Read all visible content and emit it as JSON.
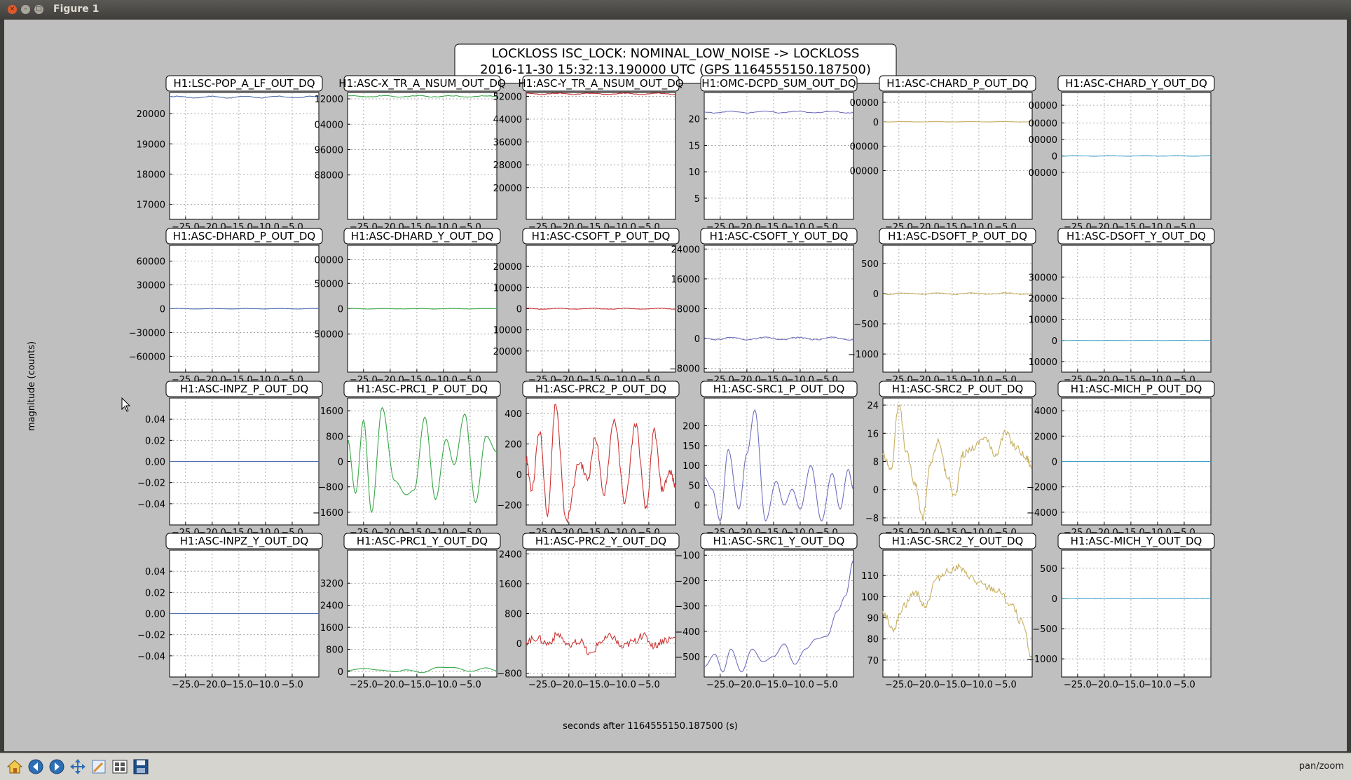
{
  "window": {
    "title": "Figure 1",
    "close_icon": "×",
    "minimize_icon": "–",
    "maximize_icon": "□"
  },
  "figure": {
    "suptitle_line1": "LOCKLOSS ISC_LOCK: NOMINAL_LOW_NOISE -> LOCKLOSS",
    "suptitle_line2": "2016-11-30 15:32:13.190000 UTC (GPS 1164555150.187500)",
    "ylabel": "magnitude (counts)",
    "xlabel": "seconds after 1164555150.187500 (s)"
  },
  "toolbar": {
    "buttons": [
      "home-icon",
      "back-icon",
      "forward-icon",
      "pan-icon",
      "zoom-icon",
      "subplots-icon",
      "save-icon"
    ],
    "status": "pan/zoom"
  },
  "colors": {
    "blue": "#4f6fb0",
    "green": "#3aa84a",
    "red": "#cc3333",
    "purple": "#6f6fbf",
    "tan": "#c8b060",
    "cyan": "#3fa0c8"
  },
  "chart_data": [
    {
      "title": "H1:LSC-POP_A_LF_OUT_DQ",
      "type": "line",
      "color": "blue",
      "ylim": [
        16500,
        20700
      ],
      "yticks": [
        "20000",
        "19000",
        "18000",
        "17000"
      ],
      "ytickvals": [
        20000,
        19000,
        18000,
        17000
      ],
      "xlim": [
        -28,
        0
      ],
      "kind": "flat",
      "level": 20550,
      "amp": 25
    },
    {
      "title": "H1:ASC-X_TR_A_NSUM_OUT_DQ",
      "type": "line",
      "color": "green",
      "ylim": [
        0,
        10
      ],
      "yticks": [
        "12000",
        "04000",
        "96000",
        "88000"
      ],
      "ytickvals": [
        9.5,
        7.5,
        5.5,
        3.5
      ],
      "xlim": [
        -28,
        0
      ],
      "kind": "flat",
      "level": 9.7,
      "amp": 0.05
    },
    {
      "title": "H1:ASC-Y_TR_A_NSUM_OUT_DQ",
      "type": "line",
      "color": "red",
      "ylim": [
        0,
        10
      ],
      "yticks": [
        "52000",
        "44000",
        "36000",
        "28000",
        "20000"
      ],
      "ytickvals": [
        9.7,
        7.9,
        6.1,
        4.3,
        2.5
      ],
      "xlim": [
        -28,
        0
      ],
      "kind": "flat",
      "level": 9.9,
      "amp": 0.05
    },
    {
      "title": "H1:OMC-DCPD_SUM_OUT_DQ",
      "type": "line",
      "color": "purple",
      "ylim": [
        1,
        25
      ],
      "yticks": [
        "20",
        "15",
        "10",
        "5"
      ],
      "ytickvals": [
        20,
        15,
        10,
        5
      ],
      "xlim": [
        -28,
        0
      ],
      "kind": "flat",
      "level": 21.3,
      "amp": 0.15
    },
    {
      "title": "H1:ASC-CHARD_P_OUT_DQ",
      "type": "line",
      "color": "tan",
      "ylim": [
        -10,
        3
      ],
      "yticks": [
        "00000",
        "0",
        "00000",
        "00000"
      ],
      "ytickvals": [
        2,
        0,
        -2.5,
        -5
      ],
      "xlim": [
        -28,
        0
      ],
      "kind": "flat",
      "level": 0,
      "amp": 0.02
    },
    {
      "title": "H1:ASC-CHARD_Y_OUT_DQ",
      "type": "line",
      "color": "cyan",
      "ylim": [
        -5,
        5
      ],
      "yticks": [
        "00000",
        "00000",
        "00000",
        "0",
        "00000"
      ],
      "ytickvals": [
        4,
        2.6,
        1.3,
        0,
        -1.3
      ],
      "xlim": [
        -28,
        0
      ],
      "kind": "flat",
      "level": 0,
      "amp": 0.02
    },
    {
      "title": "H1:ASC-DHARD_P_OUT_DQ",
      "type": "line",
      "color": "blue",
      "ylim": [
        -80000,
        80000
      ],
      "yticks": [
        "60000",
        "30000",
        "0",
        "−30000",
        "−60000"
      ],
      "ytickvals": [
        60000,
        30000,
        0,
        -30000,
        -60000
      ],
      "xlim": [
        -28,
        0
      ],
      "kind": "flat",
      "level": 0,
      "amp": 300
    },
    {
      "title": "H1:ASC-DHARD_Y_OUT_DQ",
      "type": "line",
      "color": "green",
      "ylim": [
        -80000,
        80000
      ],
      "yticks": [
        "00000",
        "50000",
        "0",
        "50000"
      ],
      "ytickvals": [
        62000,
        32000,
        0,
        -32000
      ],
      "xlim": [
        -28,
        0
      ],
      "kind": "flat",
      "level": 0,
      "amp": 300
    },
    {
      "title": "H1:ASC-CSOFT_P_OUT_DQ",
      "type": "line",
      "color": "red",
      "ylim": [
        -30000,
        30000
      ],
      "yticks": [
        "20000",
        "10000",
        "0",
        "10000",
        "20000"
      ],
      "ytickvals": [
        20000,
        10000,
        0,
        -10000,
        -20000
      ],
      "xlim": [
        -28,
        0
      ],
      "kind": "flat",
      "level": 0,
      "amp": 200
    },
    {
      "title": "H1:ASC-CSOFT_Y_OUT_DQ",
      "type": "line",
      "color": "purple",
      "ylim": [
        -9000,
        25000
      ],
      "yticks": [
        "24000",
        "16000",
        "8000",
        "0",
        "−8000"
      ],
      "ytickvals": [
        24000,
        16000,
        8000,
        0,
        -8000
      ],
      "xlim": [
        -28,
        0
      ],
      "kind": "flat",
      "level": 0,
      "amp": 300
    },
    {
      "title": "H1:ASC-DSOFT_P_OUT_DQ",
      "type": "line",
      "color": "tan",
      "ylim": [
        -1300,
        800
      ],
      "yticks": [
        "500",
        "0",
        "−500",
        "−1000"
      ],
      "ytickvals": [
        500,
        0,
        -500,
        -1000
      ],
      "xlim": [
        -28,
        0
      ],
      "kind": "flat",
      "level": 0,
      "amp": 12
    },
    {
      "title": "H1:ASC-DSOFT_Y_OUT_DQ",
      "type": "line",
      "color": "cyan",
      "ylim": [
        -15000,
        45000
      ],
      "yticks": [
        "30000",
        "20000",
        "10000",
        "0",
        "10000"
      ],
      "ytickvals": [
        30000,
        20000,
        10000,
        0,
        -10000
      ],
      "xlim": [
        -28,
        0
      ],
      "kind": "flat",
      "level": 0,
      "amp": 50
    },
    {
      "title": "H1:ASC-INPZ_P_OUT_DQ",
      "type": "line",
      "color": "blue",
      "ylim": [
        -0.06,
        0.06
      ],
      "yticks": [
        "0.04",
        "0.02",
        "0.00",
        "−0.02",
        "−0.04"
      ],
      "ytickvals": [
        0.04,
        0.02,
        0,
        -0.02,
        -0.04
      ],
      "xlim": [
        -28,
        0
      ],
      "kind": "flat",
      "level": 0,
      "amp": 0
    },
    {
      "title": "H1:ASC-PRC1_P_OUT_DQ",
      "type": "line",
      "color": "green",
      "ylim": [
        -2000,
        2000
      ],
      "yticks": [
        "1600",
        "800",
        "0",
        "−800",
        "−1600"
      ],
      "ytickvals": [
        1600,
        800,
        0,
        -800,
        -1600
      ],
      "xlim": [
        -28,
        0
      ],
      "kind": "osc",
      "points": [
        [
          -28,
          700
        ],
        [
          -26.5,
          -1000
        ],
        [
          -25,
          1300
        ],
        [
          -23.5,
          -1600
        ],
        [
          -21.5,
          1700
        ],
        [
          -19.2,
          -600
        ],
        [
          -17,
          -1050
        ],
        [
          -15.5,
          -900
        ],
        [
          -13.5,
          1400
        ],
        [
          -11.5,
          -1200
        ],
        [
          -9.5,
          700
        ],
        [
          -8,
          -100
        ],
        [
          -6,
          1500
        ],
        [
          -4,
          -1300
        ],
        [
          -2,
          800
        ],
        [
          0,
          300
        ]
      ]
    },
    {
      "title": "H1:ASC-PRC2_P_OUT_DQ",
      "type": "line",
      "color": "red",
      "ylim": [
        -330,
        500
      ],
      "yticks": [
        "400",
        "200",
        "0",
        "−200"
      ],
      "ytickvals": [
        400,
        200,
        0,
        -200
      ],
      "xlim": [
        -28,
        0
      ],
      "kind": "osc",
      "noisy": true,
      "points": [
        [
          -28,
          100
        ],
        [
          -27,
          -100
        ],
        [
          -25.5,
          280
        ],
        [
          -24,
          -250
        ],
        [
          -22.5,
          460
        ],
        [
          -20.5,
          -300
        ],
        [
          -18,
          80
        ],
        [
          -16.5,
          -30
        ],
        [
          -15,
          240
        ],
        [
          -13.5,
          -130
        ],
        [
          -11.5,
          360
        ],
        [
          -9.5,
          -180
        ],
        [
          -7.5,
          330
        ],
        [
          -5.5,
          -230
        ],
        [
          -4,
          290
        ],
        [
          -2.5,
          -100
        ],
        [
          -1,
          20
        ],
        [
          0,
          -80
        ]
      ]
    },
    {
      "title": "H1:ASC-SRC1_P_OUT_DQ",
      "type": "line",
      "color": "purple",
      "ylim": [
        -50,
        270
      ],
      "yticks": [
        "200",
        "150",
        "100",
        "50",
        "0"
      ],
      "ytickvals": [
        200,
        150,
        100,
        50,
        0
      ],
      "xlim": [
        -28,
        0
      ],
      "kind": "osc",
      "points": [
        [
          -28,
          70
        ],
        [
          -26.5,
          40
        ],
        [
          -25,
          -40
        ],
        [
          -23.5,
          140
        ],
        [
          -21.5,
          -10
        ],
        [
          -20,
          130
        ],
        [
          -18.5,
          240
        ],
        [
          -16.5,
          -40
        ],
        [
          -14.5,
          60
        ],
        [
          -13,
          0
        ],
        [
          -11.5,
          40
        ],
        [
          -10,
          -10
        ],
        [
          -8,
          100
        ],
        [
          -6,
          -40
        ],
        [
          -4,
          80
        ],
        [
          -2.5,
          -10
        ],
        [
          -1,
          90
        ],
        [
          0,
          40
        ]
      ]
    },
    {
      "title": "H1:ASC-SRC2_P_OUT_DQ",
      "type": "line",
      "color": "tan",
      "ylim": [
        -10,
        26
      ],
      "yticks": [
        "24",
        "16",
        "8",
        "0",
        "−8"
      ],
      "ytickvals": [
        24,
        16,
        8,
        0,
        -8
      ],
      "xlim": [
        -28,
        0
      ],
      "kind": "osc",
      "noisy": true,
      "points": [
        [
          -28,
          10
        ],
        [
          -26.5,
          6
        ],
        [
          -25,
          24
        ],
        [
          -23.5,
          10
        ],
        [
          -22,
          2
        ],
        [
          -20.5,
          -8
        ],
        [
          -19,
          8
        ],
        [
          -17.5,
          14
        ],
        [
          -16,
          4
        ],
        [
          -14.5,
          -2
        ],
        [
          -13,
          10
        ],
        [
          -11,
          12
        ],
        [
          -9,
          15
        ],
        [
          -7,
          10
        ],
        [
          -5,
          16
        ],
        [
          -3,
          12
        ],
        [
          -1,
          9
        ],
        [
          0,
          6
        ]
      ]
    },
    {
      "title": "H1:ASC-MICH_P_OUT_DQ",
      "type": "line",
      "color": "cyan",
      "ylim": [
        -5000,
        5000
      ],
      "yticks": [
        "4000",
        "2000",
        "0",
        "−2000",
        "−4000"
      ],
      "ytickvals": [
        4000,
        2000,
        0,
        -2000,
        -4000
      ],
      "xlim": [
        -28,
        0
      ],
      "kind": "flat",
      "level": 0,
      "amp": 5
    },
    {
      "title": "H1:ASC-INPZ_Y_OUT_DQ",
      "type": "line",
      "color": "blue",
      "ylim": [
        -0.06,
        0.06
      ],
      "yticks": [
        "0.04",
        "0.02",
        "0.00",
        "−0.02",
        "−0.04"
      ],
      "ytickvals": [
        0.04,
        0.02,
        0,
        -0.02,
        -0.04
      ],
      "xlim": [
        -28,
        0
      ],
      "kind": "flat",
      "level": 0,
      "amp": 0
    },
    {
      "title": "H1:ASC-PRC1_Y_OUT_DQ",
      "type": "line",
      "color": "green",
      "ylim": [
        -200,
        4400
      ],
      "yticks": [
        "3200",
        "2400",
        "1600",
        "800",
        "0"
      ],
      "ytickvals": [
        3200,
        2400,
        1600,
        800,
        0
      ],
      "xlim": [
        -28,
        0
      ],
      "kind": "osc",
      "points": [
        [
          -28,
          40
        ],
        [
          -25,
          110
        ],
        [
          -22,
          50
        ],
        [
          -19,
          -10
        ],
        [
          -17,
          60
        ],
        [
          -14,
          -40
        ],
        [
          -11,
          150
        ],
        [
          -8,
          140
        ],
        [
          -5,
          0
        ],
        [
          -2,
          130
        ],
        [
          0,
          30
        ]
      ]
    },
    {
      "title": "H1:ASC-PRC2_Y_OUT_DQ",
      "type": "line",
      "color": "red",
      "ylim": [
        -900,
        2500
      ],
      "yticks": [
        "2400",
        "1600",
        "800",
        "0",
        "−800"
      ],
      "ytickvals": [
        2400,
        1600,
        800,
        0,
        -800
      ],
      "xlim": [
        -28,
        0
      ],
      "kind": "osc",
      "noisy": true,
      "points": [
        [
          -28,
          60
        ],
        [
          -26,
          150
        ],
        [
          -24,
          0
        ],
        [
          -22,
          250
        ],
        [
          -20,
          -100
        ],
        [
          -18,
          60
        ],
        [
          -16,
          -300
        ],
        [
          -14,
          60
        ],
        [
          -12,
          200
        ],
        [
          -10,
          -100
        ],
        [
          -8,
          50
        ],
        [
          -6,
          200
        ],
        [
          -4,
          -50
        ],
        [
          -2,
          100
        ],
        [
          0,
          150
        ]
      ]
    },
    {
      "title": "H1:ASC-SRC1_Y_OUT_DQ",
      "type": "line",
      "color": "purple",
      "ylim": [
        -580,
        -80
      ],
      "yticks": [
        "−100",
        "−200",
        "−300",
        "−400",
        "−500"
      ],
      "ytickvals": [
        -100,
        -200,
        -300,
        -400,
        -500
      ],
      "xlim": [
        -28,
        0
      ],
      "kind": "osc",
      "points": [
        [
          -28,
          -540
        ],
        [
          -26,
          -490
        ],
        [
          -24.5,
          -560
        ],
        [
          -23,
          -470
        ],
        [
          -21,
          -560
        ],
        [
          -19,
          -470
        ],
        [
          -17,
          -520
        ],
        [
          -15,
          -500
        ],
        [
          -13,
          -450
        ],
        [
          -11,
          -530
        ],
        [
          -9,
          -470
        ],
        [
          -7,
          -430
        ],
        [
          -5,
          -420
        ],
        [
          -3,
          -320
        ],
        [
          -1.5,
          -260
        ],
        [
          0,
          -120
        ]
      ]
    },
    {
      "title": "H1:ASC-SRC2_Y_OUT_DQ",
      "type": "line",
      "color": "tan",
      "ylim": [
        62,
        122
      ],
      "yticks": [
        "110",
        "100",
        "90",
        "80",
        "70"
      ],
      "ytickvals": [
        110,
        100,
        90,
        80,
        70
      ],
      "xlim": [
        -28,
        0
      ],
      "kind": "osc",
      "noisy": true,
      "points": [
        [
          -28,
          92
        ],
        [
          -26,
          85
        ],
        [
          -24,
          96
        ],
        [
          -22,
          102
        ],
        [
          -20,
          96
        ],
        [
          -18,
          108
        ],
        [
          -16,
          112
        ],
        [
          -14,
          114
        ],
        [
          -12,
          110
        ],
        [
          -10,
          106
        ],
        [
          -8,
          104
        ],
        [
          -6,
          102
        ],
        [
          -4,
          96
        ],
        [
          -2,
          88
        ],
        [
          0,
          70
        ]
      ]
    },
    {
      "title": "H1:ASC-MICH_Y_OUT_DQ",
      "type": "line",
      "color": "cyan",
      "ylim": [
        -1300,
        800
      ],
      "yticks": [
        "500",
        "0",
        "−500",
        "−1000"
      ],
      "ytickvals": [
        500,
        0,
        -500,
        -1000
      ],
      "xlim": [
        -28,
        0
      ],
      "kind": "flat",
      "level": 0,
      "amp": 3
    }
  ],
  "xticks": [
    "−25.0",
    "−20.0",
    "−15.0",
    "−10.0",
    "−5.0"
  ],
  "xtickvals": [
    -25,
    -20,
    -15,
    -10,
    -5
  ]
}
